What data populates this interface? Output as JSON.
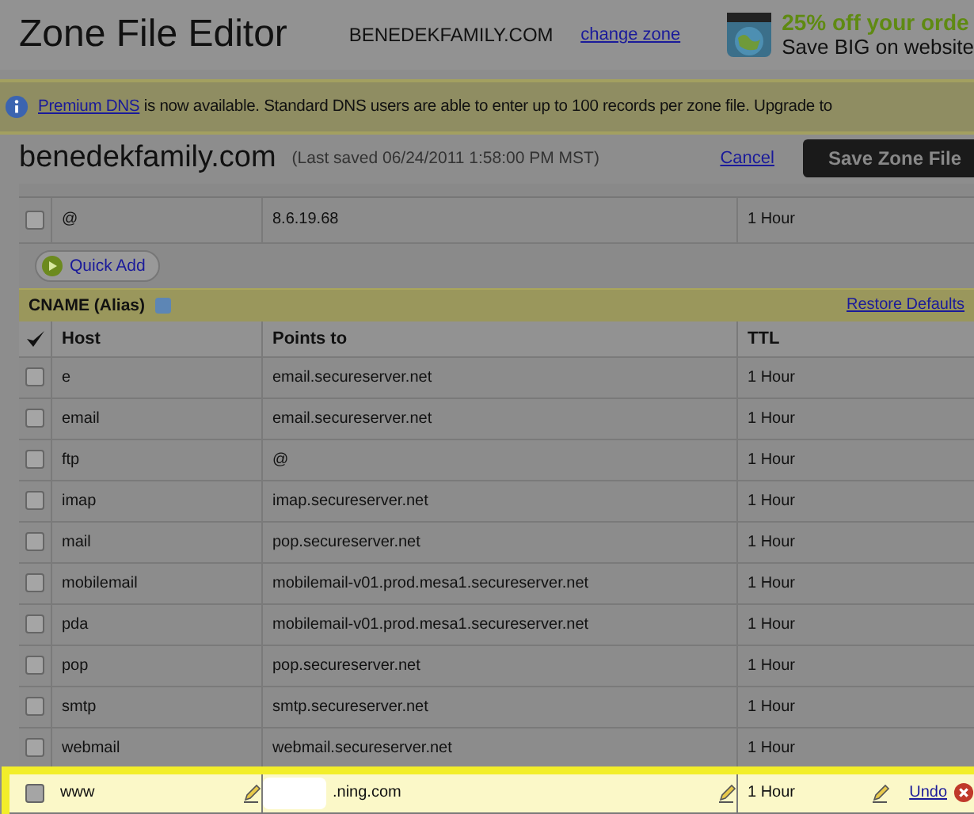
{
  "header": {
    "title": "Zone File Editor",
    "domain": "BENEDEKFAMILY.COM",
    "change_zone": "change zone",
    "promo": {
      "headline": "25% off your orde",
      "subline": "Save BIG on website"
    }
  },
  "notice": {
    "link": "Premium DNS",
    "text": " is now available. Standard DNS users are able to enter up to 100 records per zone file. Upgrade to"
  },
  "zone": {
    "name": "benedekfamily.com",
    "last_saved": "(Last saved 06/24/2011 1:58:00 PM MST)",
    "cancel": "Cancel",
    "save": "Save Zone File"
  },
  "a_records": {
    "rows": [
      {
        "host": "@",
        "points_to": "8.6.19.68",
        "ttl": "1 Hour",
        "checked": false
      }
    ],
    "quick_add": "Quick Add"
  },
  "cname": {
    "title": "CNAME (Alias)",
    "restore": "Restore Defaults",
    "columns": [
      "Host",
      "Points to",
      "TTL"
    ],
    "rows": [
      {
        "host": "e",
        "points_to": "email.secureserver.net",
        "ttl": "1 Hour",
        "checked": false,
        "editing": false
      },
      {
        "host": "email",
        "points_to": "email.secureserver.net",
        "ttl": "1 Hour",
        "checked": false,
        "editing": false
      },
      {
        "host": "ftp",
        "points_to": "@",
        "ttl": "1 Hour",
        "checked": false,
        "editing": false
      },
      {
        "host": "imap",
        "points_to": "imap.secureserver.net",
        "ttl": "1 Hour",
        "checked": false,
        "editing": false
      },
      {
        "host": "mail",
        "points_to": "pop.secureserver.net",
        "ttl": "1 Hour",
        "checked": false,
        "editing": false
      },
      {
        "host": "mobilemail",
        "points_to": "mobilemail-v01.prod.mesa1.secureserver.net",
        "ttl": "1 Hour",
        "checked": false,
        "editing": false
      },
      {
        "host": "pda",
        "points_to": "mobilemail-v01.prod.mesa1.secureserver.net",
        "ttl": "1 Hour",
        "checked": false,
        "editing": false
      },
      {
        "host": "pop",
        "points_to": "pop.secureserver.net",
        "ttl": "1 Hour",
        "checked": false,
        "editing": false
      },
      {
        "host": "smtp",
        "points_to": "smtp.secureserver.net",
        "ttl": "1 Hour",
        "checked": false,
        "editing": false
      },
      {
        "host": "webmail",
        "points_to": "webmail.secureserver.net",
        "ttl": "1 Hour",
        "checked": false,
        "editing": false
      },
      {
        "host": "www",
        "points_to": ".ning.com",
        "ttl": "1 Hour",
        "checked": false,
        "editing": true,
        "undo": "Undo"
      }
    ]
  }
}
